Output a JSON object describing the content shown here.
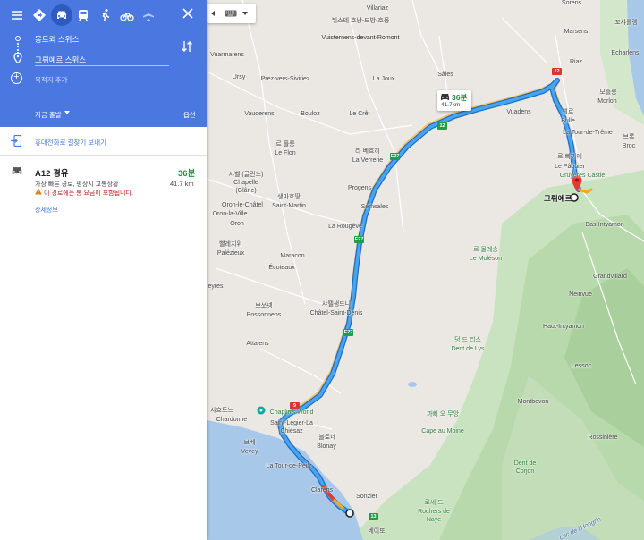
{
  "modes": [
    {
      "name": "best-mode",
      "icon": "diamond-route-icon"
    },
    {
      "name": "driving",
      "icon": "car-icon"
    },
    {
      "name": "transit",
      "icon": "train-icon"
    },
    {
      "name": "walking",
      "icon": "walk-icon"
    },
    {
      "name": "cycling",
      "icon": "bicycle-icon"
    },
    {
      "name": "flight",
      "icon": "plane-icon"
    }
  ],
  "active_mode": "driving",
  "origin": "몽트뢰 스위스",
  "destination": "그뤼예르 스위스",
  "add_destination": "목적지 추가",
  "depart_label": "지금 출발",
  "options_label": "옵션",
  "send_to_phone": "휴대전화로 길찾기 보내기",
  "route": {
    "title": "A12 경유",
    "time": "36분",
    "distance": "41.7 km",
    "description": "가장 빠른 경로, 평상시 교통상황",
    "warning": "이 경로에는 통 요금이 포함됩니다.",
    "details": "상세정보"
  },
  "callout": {
    "time": "36분",
    "distance": "41.7km"
  },
  "map_labels": {
    "villariaz": "Villariaz",
    "vuisternens_ko": "뷔스테\n호낭-드방-호몽",
    "vuisternens": "Vuisternens-devant-Romont",
    "sorens": "Sorens",
    "marsens": "Marsens",
    "echarlens_ko": "꼬샤를랭",
    "echarlens": "Echarlens",
    "vuarmarens": "Vuarmarens",
    "ursy": "Ursy",
    "prez": "Prez-vers-Siviriez",
    "la_joux": "La Joux",
    "sales": "Sâles",
    "riaz": "Riaz",
    "morlon_ko": "모흘롱",
    "morlon": "Morlon",
    "vauderens": "Vauderens",
    "bouloz": "Bouloz",
    "le_cret": "Le Crêt",
    "vuadens": "Vuadens",
    "bulle_ko": "뷜르",
    "bulle": "Bulle",
    "la_tour_treme": "La Tour-de-Trême",
    "broc_ko": "브록",
    "broc": "Broc",
    "le_flon_ko": "르 플롱",
    "le_flon": "Le Flon",
    "la_verrerie_ko": "라 베흐히",
    "la_verrerie": "La Verrerie",
    "le_paquier_ko": "르 빠끼에",
    "le_paquier": "Le Pâquier",
    "gruyeres_castle": "Gruyères Castle",
    "chapelle_ko": "샤벨 (글란느)",
    "chapelle": "Chapelle\n(Glâne)",
    "progens": "Progens",
    "destination_label": "그뤼예르",
    "oron_chatel": "Oron-le-Châtel",
    "saint_martin_ko": "생마흐땅",
    "saint_martin": "Saint-Martin",
    "semsales": "Semsales",
    "oron_ville": "Oron-la-Ville",
    "oron": "Oron",
    "bas_intyamon": "Bas-Intyamon",
    "la_rougeve": "La Rougève",
    "palezieux_ko": "빨레지위",
    "palezieux": "Palézieux",
    "moleson_ko": "르 몰레송",
    "moleson": "Le Moléson",
    "maracon": "Maracon",
    "ecoteaux": "Écoteaux",
    "grandvillard": "Grandvillard",
    "ayes": "eyres",
    "neirivue": "Neirivue",
    "bossonnens_ko": "보쏘넹",
    "bossonnens": "Bossonnens",
    "chatel_ko": "샤뗄생드니",
    "chatel": "Châtel-Saint-Denis",
    "haut_intyamon": "Haut-Intyamon",
    "attalens": "Attalens",
    "dent_lys_ko": "덩 드 리스",
    "dent_lys": "Dent de Lys",
    "lessoc": "Lessoc",
    "montbovon": "Montbovon",
    "chardonne_ko": "샤흐도느",
    "chardonne": "Chardonne",
    "chaplin": "Chaplin's World",
    "st_legier": "Saint-Légier-La\nChiésaz",
    "blonay_ko": "블로네",
    "blonay": "Blonay",
    "jaman_ko": "까뻐 오 무앙",
    "jaman": "Cape au Moine",
    "rossiniere": "Rossinière",
    "vevey_ko": "브베",
    "vevey": "Vevey",
    "tour_peilz": "La Tour-de-Peilz",
    "clarens": "Clarens",
    "sonzier": "Sonzier",
    "rochers_ko": "로셰 드",
    "rochers": "Rochers de\nNaye",
    "dent_corjon": "Dent de\nCorjon",
    "montreux_ko": "베이또",
    "hongrin": "Lac de l'Hongrin"
  },
  "shields": {
    "a12_top": "12",
    "a12_mid": "12",
    "e27_a": "E27",
    "e27_b": "E27",
    "e27_c": "E27",
    "a9": "9",
    "a13": "13"
  },
  "colors": {
    "header": "#4a78e0",
    "route": "#3a8ee6",
    "route_time": "#1e8e3e",
    "warning": "#c5221f"
  }
}
